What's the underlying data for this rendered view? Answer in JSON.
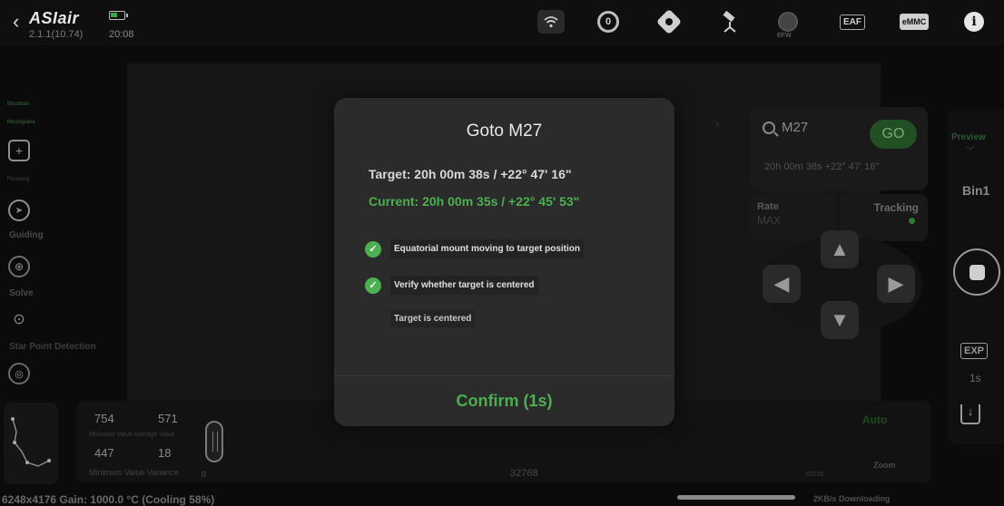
{
  "header": {
    "brand": "ASIair",
    "version": "2.1.1(10.74)",
    "clock": "20:08",
    "efw_tag": "EFW",
    "eaf_label": "EAF",
    "emmc_label": "eMMC",
    "info_label": "i",
    "camera_label": "0"
  },
  "left_tools": {
    "mount_tiny": "Mountain",
    "mount_tiny2": "Mosinglane",
    "focusing_tiny": "Focusing",
    "guiding": "Guiding",
    "solve": "Solve",
    "star_point_detection": "Star Point Detection"
  },
  "right_column": {
    "preview": "Preview",
    "bin": "Bin1",
    "exp_label": "EXP",
    "exp_value": "1s"
  },
  "goto_panel": {
    "search_value": "M27",
    "go_label": "GO",
    "coords": "20h 00m 38s  +22° 47' 16\"",
    "rate_label": "Rate",
    "rate_value": "MAX",
    "tracking_label": "Tracking"
  },
  "histogram": {
    "min": "754",
    "max": "571",
    "value": "447",
    "variance": "18",
    "caption_top": "Minimum  Value  Average Value",
    "caption_bottom": "Minimum Value Variance",
    "tick_zero": "0",
    "tick_mid": "32768",
    "tick_max": "65535",
    "auto_label": "Auto",
    "zoom_label": "Zoom"
  },
  "status": {
    "camera_info": "6248x4176 Gain: 1000.0 °C (Cooling 58%)",
    "download": "2KB/s Downloading"
  },
  "modal": {
    "title": "Goto M27",
    "target": "Target: 20h 00m 38s / +22° 47' 16\"",
    "current": "Current: 20h 00m 35s / +22° 45' 53\"",
    "step1": "Equatorial mount moving to target position",
    "step2": "Verify whether target is centered",
    "step2_sub": "Target is centered",
    "confirm": "Confirm (1s)"
  },
  "colors": {
    "accent_green": "#4caf50",
    "modal_bg": "#2b2b2b"
  }
}
